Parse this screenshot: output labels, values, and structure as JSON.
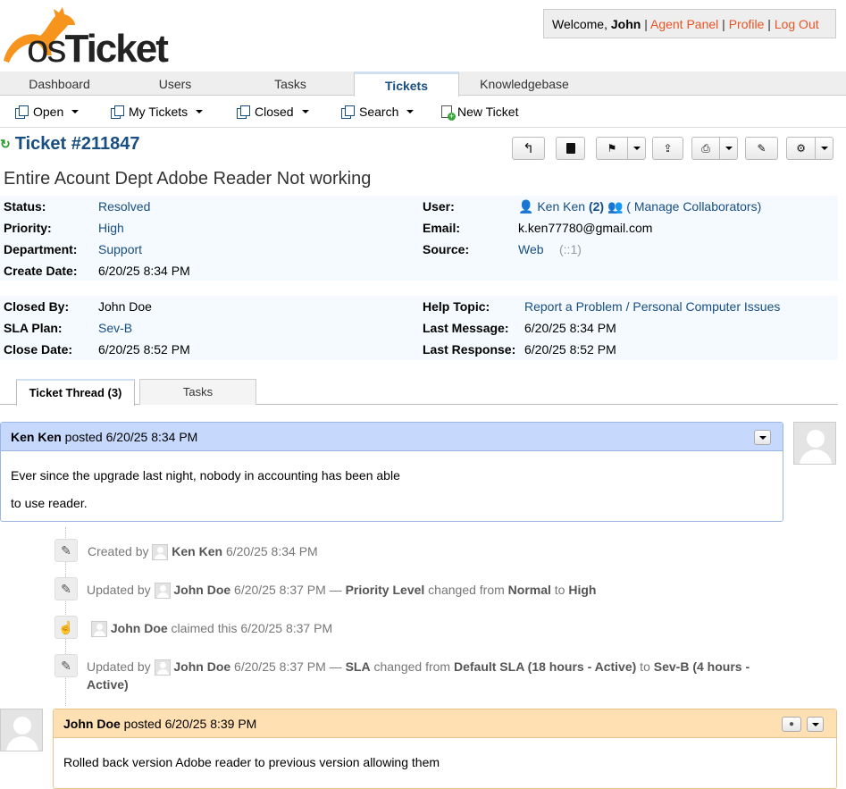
{
  "brand": {
    "logo_text_os": "os",
    "logo_text_ticket": "Ticket"
  },
  "header": {
    "welcome": "Welcome, ",
    "user": "John",
    ".": ".",
    "agent_panel": "Agent Panel",
    "profile": "Profile",
    "logout": "Log Out"
  },
  "nav": {
    "tabs": [
      "Dashboard",
      "Users",
      "Tasks",
      "Tickets",
      "Knowledgebase"
    ]
  },
  "subnav": {
    "open": "Open",
    "my_tickets": "My Tickets",
    "closed": "Closed",
    "search": "Search",
    "new_ticket": "New Ticket"
  },
  "ticket": {
    "number": "Ticket #211847",
    "subject": "Entire Acount Dept Adobe Reader Not working",
    "status_label": "Status:",
    "status": "Resolved",
    "priority_label": "Priority:",
    "priority": "High",
    "department_label": "Department:",
    "department": "Support",
    "create_date_label": "Create Date:",
    "create_date": "6/20/25 8:34 PM",
    "user_label": "User:",
    "user": "Ken Ken",
    "user_count": "(2)",
    "collab": "( Manage Collaborators)",
    "email_label": "Email:",
    "email": "k.ken77780@gmail.com",
    "source_label": "Source:",
    "source": "Web",
    "source_ip": "(::1)",
    "closed_by_label": "Closed By:",
    "closed_by": "John Doe",
    "sla_label": "SLA Plan:",
    "sla": "Sev-B",
    "close_date_label": "Close Date:",
    "close_date": "6/20/25 8:52 PM",
    "help_topic_label": "Help Topic:",
    "help_topic": "Report a Problem / Personal Computer Issues",
    "last_message_label": "Last Message:",
    "last_message": "6/20/25 8:34 PM",
    "last_response_label": "Last Response:",
    "last_response": "6/20/25 8:52 PM"
  },
  "thread_tabs": {
    "thread": "Ticket Thread (3)",
    "tasks": "Tasks"
  },
  "thread": {
    "msg1": {
      "author": "Ken Ken",
      "posted": " posted 6/20/25 8:34 PM",
      "line1": "Ever since the upgrade last night, nobody in accounting has been able",
      "line2": "to use reader."
    },
    "ev1": {
      "pre": "Created by ",
      "who": "Ken Ken",
      "when": " 6/20/25 8:34 PM"
    },
    "ev2": {
      "pre": "Updated by ",
      "who": "John Doe",
      "when": " 6/20/25 8:37 PM — ",
      "field": "Priority Level",
      "mid": " changed from ",
      "from": "Normal",
      "to_word": " to ",
      "to": "High"
    },
    "ev3": {
      "who": "John Doe",
      "rest": " claimed this 6/20/25 8:37 PM"
    },
    "ev4": {
      "pre": "Updated by ",
      "who": "John Doe",
      "when": " 6/20/25 8:37 PM — ",
      "field": "SLA",
      "mid": " changed from ",
      "from": "Default SLA (18 hours - Active)",
      "to_word": " to ",
      "to": "Sev-B (4 hours -",
      "to2": "Active)"
    },
    "msg2": {
      "author": "John Doe",
      "posted": " posted 6/20/25 8:39 PM",
      "line1": "Rolled back version Adobe reader to previous version allowing them"
    }
  },
  "colors": {
    "accent": "#184E81",
    "link_orange": "#E65524",
    "client_header": "#C6D8FC",
    "staff_header": "#FFE0B3"
  }
}
